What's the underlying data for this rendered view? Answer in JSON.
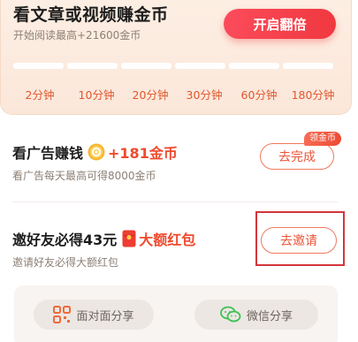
{
  "read_card": {
    "title": "看文章或视频赚金币",
    "subtitle": "开始阅读最高+21600金币",
    "double_button": "开启翻倍",
    "progress_fraction": 0,
    "time_labels": [
      "2分钟",
      "10分钟",
      "20分钟",
      "30分钟",
      "60分钟",
      "180分钟"
    ]
  },
  "ad_task": {
    "title": "看广告赚钱",
    "reward": "+181金币",
    "subtitle": "看广告每天最高可得8000金币",
    "button": "去完成",
    "badge": "领金币"
  },
  "invite_task": {
    "title": "邀好友必得43元",
    "reward": "大额红包",
    "subtitle": "邀请好友必得大额红包",
    "button": "去邀请"
  },
  "share": {
    "face_to_face": "面对面分享",
    "wechat": "微信分享"
  },
  "colors": {
    "accent_red": "#f0383f",
    "reward_orange": "#ef4a2d",
    "time_label": "#e0562c",
    "highlight_box": "#d2363c",
    "wechat_green": "#3fc152",
    "qr_orange": "#ef6a3a"
  },
  "icons": {
    "coin": "coin-icon",
    "red_packet": "red-packet-icon",
    "qr": "qr-code-icon",
    "wechat": "wechat-icon"
  }
}
